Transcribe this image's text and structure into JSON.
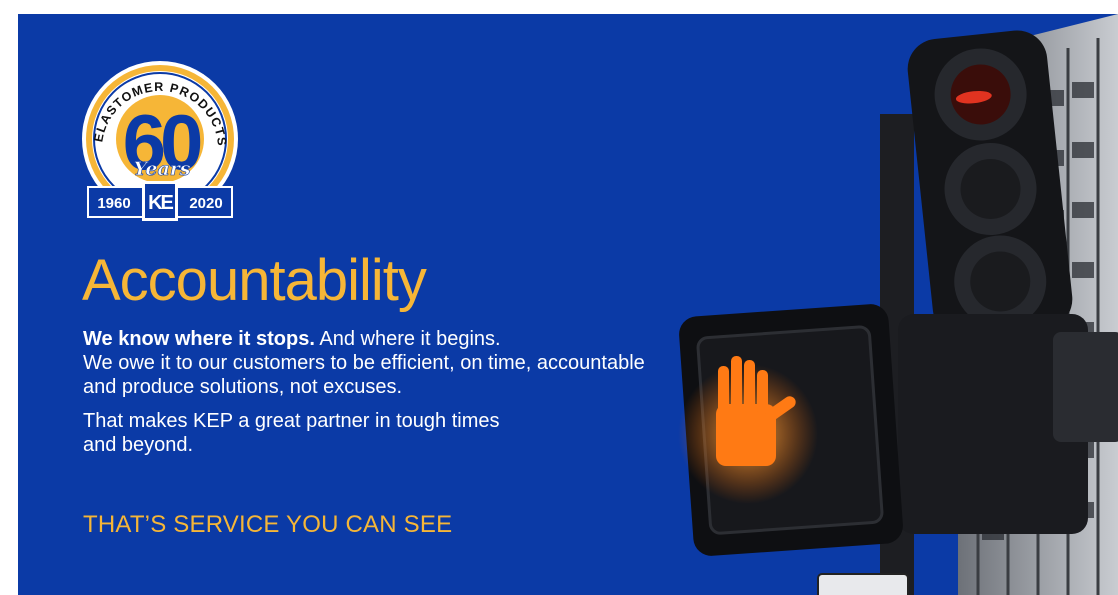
{
  "colors": {
    "background": "#0b3aa6",
    "accent": "#f6b637",
    "text": "#ffffff",
    "signal_orange": "#ff7a14"
  },
  "logo": {
    "arc_text": "KENT ELASTOMER PRODUCTS, INC.",
    "number": "60",
    "years_label": "Years",
    "start_year": "1960",
    "end_year": "2020",
    "monogram": "KE"
  },
  "headline": "Accountability",
  "body": {
    "lead_bold": "We know where it stops.",
    "lead_rest": " And where it begins.",
    "paragraph1_rest": "We owe it to our customers to be efficient, on time, accountable and produce solutions, not excuses.",
    "paragraph2": "That makes KEP a great partner in tough times and beyond."
  },
  "tagline": "THAT’S SERVICE YOU CAN SEE",
  "photo": {
    "subject": "traffic-light-icon",
    "signal": "hand-icon"
  }
}
